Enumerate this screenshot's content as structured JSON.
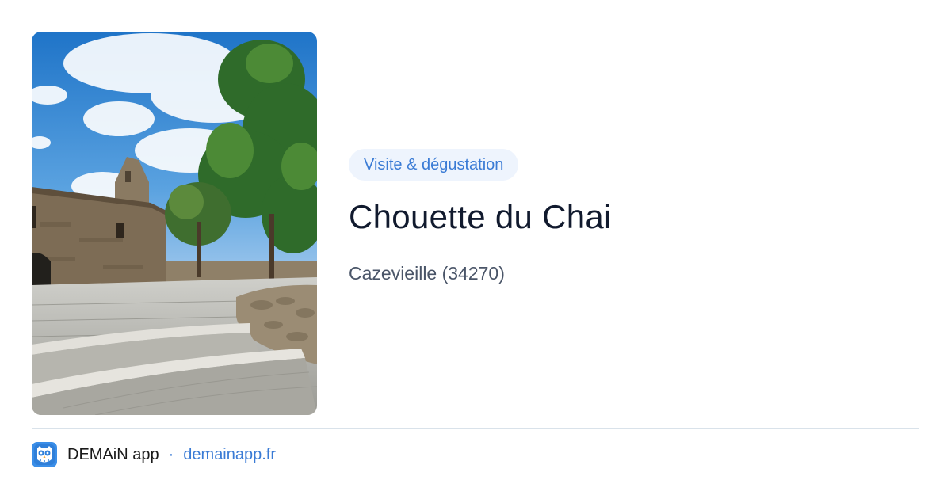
{
  "card": {
    "category": "Visite & dégustation",
    "title": "Chouette du Chai",
    "location": "Cazevieille (34270)",
    "image": "stone-chapel-courtyard-photo"
  },
  "footer": {
    "app_icon": "owl-app-icon",
    "app_name": "DEMAiN app",
    "separator": "·",
    "link_text": "demainapp.fr"
  },
  "colors": {
    "accent": "#3a7bd5",
    "badge_bg": "#eef4fd",
    "title": "#111a2e",
    "subtitle": "#4a5568",
    "divider": "#d9e2ea"
  }
}
